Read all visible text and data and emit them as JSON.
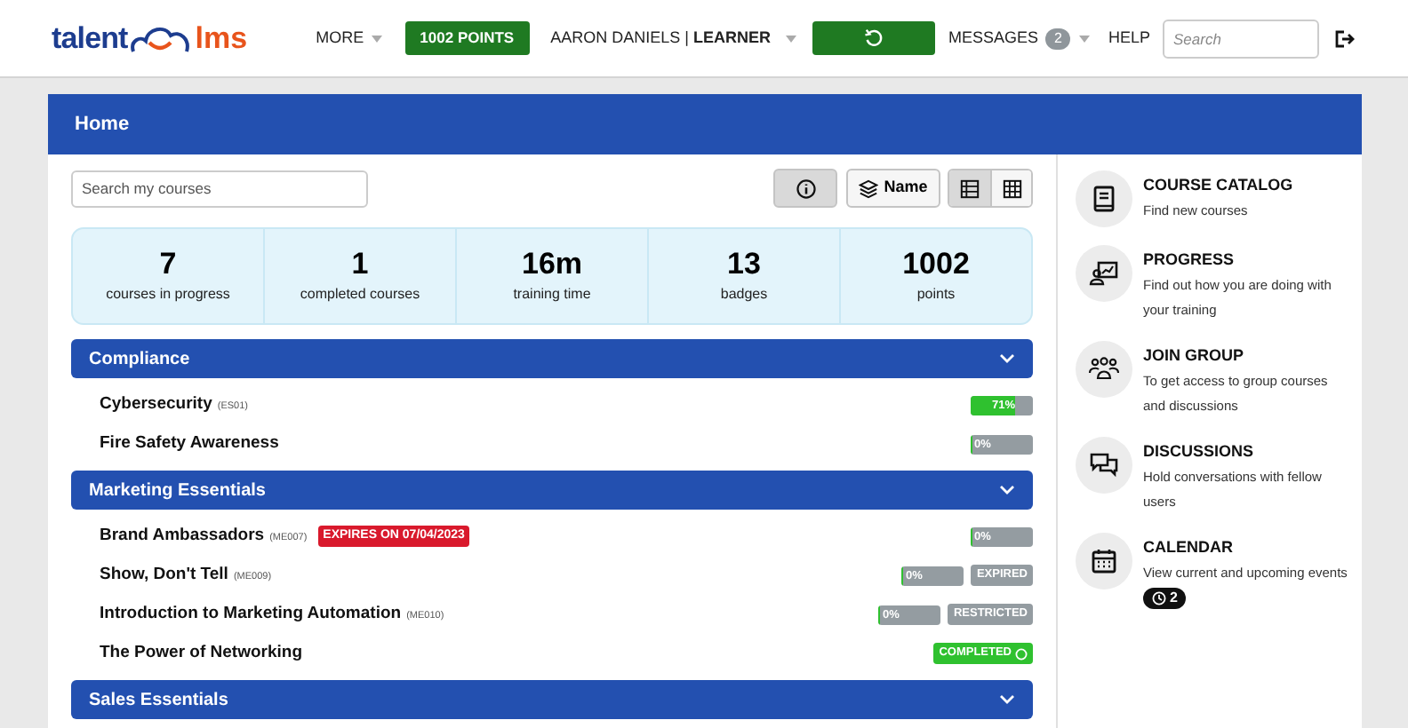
{
  "header": {
    "logo": {
      "left": "talent",
      "right": "lms"
    },
    "more": "MORE",
    "points_button": "1002 POINTS",
    "user": "AARON DANIELS | **LEARNER**",
    "messages": {
      "label": "MESSAGES",
      "count": "2"
    },
    "help": "HELP",
    "search": {
      "placeholder": "Search"
    }
  },
  "panel": {
    "title": "Home",
    "search": {
      "placeholder": "Search my courses"
    },
    "toolbar": {
      "info_selected": true,
      "sort_label": "Name",
      "views": [
        {
          "kind": "list",
          "selected": true
        },
        {
          "kind": "grid",
          "selected": false
        }
      ]
    },
    "stats": [
      {
        "value": "7",
        "label": "courses in progress"
      },
      {
        "value": "1",
        "label": "completed courses"
      },
      {
        "value": "16m",
        "label": "training time"
      },
      {
        "value": "13",
        "label": "badges"
      },
      {
        "value": "1002",
        "label": "points"
      }
    ],
    "categories": [
      {
        "name": "Compliance",
        "expanded": true,
        "courses": [
          {
            "title": "Cybersecurity",
            "code": "(ES01)",
            "progress": {
              "level": 0.71,
              "label": "71%"
            }
          },
          {
            "title": "Fire Safety Awareness",
            "progress": {
              "level": 0.02,
              "label": "0%"
            }
          }
        ]
      },
      {
        "name": "Marketing Essentials",
        "expanded": true,
        "courses": [
          {
            "title": "Brand Ambassadors",
            "code": "(ME007)",
            "expiry": "EXPIRES ON 07/04/2023",
            "progress": {
              "level": 0.02,
              "label": "0%"
            }
          },
          {
            "title": "Show, Don't Tell",
            "code": "(ME009)",
            "progress": {
              "level": 0.02,
              "label": "0%"
            },
            "status": {
              "kind": "expired",
              "text": "EXPIRED"
            }
          },
          {
            "title": "Introduction to Marketing Automation",
            "code": "(ME010)",
            "progress": {
              "level": 0.02,
              "label": "0%"
            },
            "status": {
              "kind": "restricted",
              "text": "RESTRICTED"
            }
          },
          {
            "title": "The Power of Networking",
            "status": {
              "kind": "completed",
              "text": "COMPLETED"
            }
          }
        ]
      },
      {
        "name": "Sales Essentials",
        "expanded": true
      }
    ]
  },
  "sidebar": [
    {
      "kind": "catalog",
      "title": "COURSE CATALOG",
      "description": "Find new courses"
    },
    {
      "kind": "progress",
      "title": "PROGRESS",
      "description": "Find out how you are doing with your training"
    },
    {
      "kind": "group",
      "title": "JOIN GROUP",
      "description": "To get access to group courses and discussions"
    },
    {
      "kind": "discussions",
      "title": "DISCUSSIONS",
      "description": "Hold conversations with fellow users"
    },
    {
      "kind": "calendar",
      "title": "CALENDAR",
      "description": "View current and upcoming events",
      "badge": "2"
    }
  ]
}
